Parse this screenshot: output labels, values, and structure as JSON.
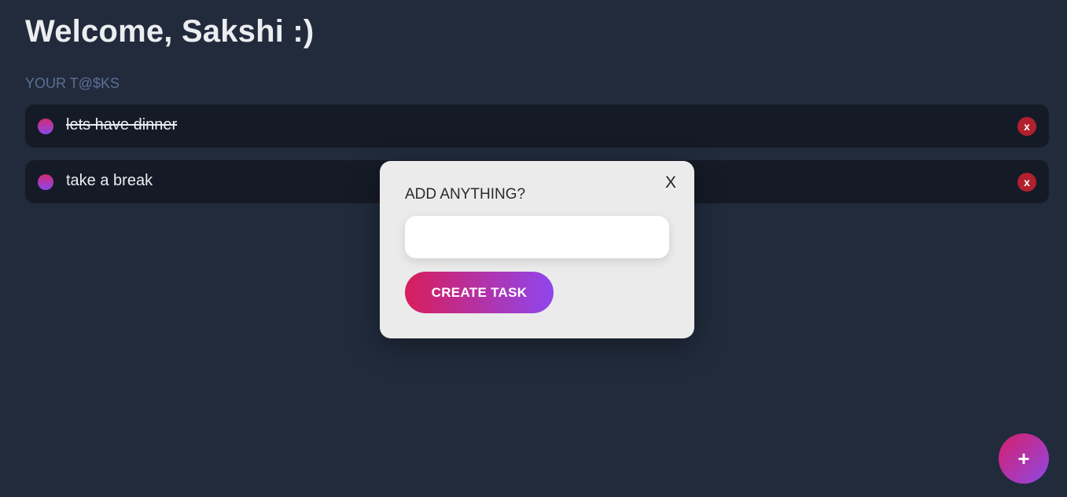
{
  "header": {
    "welcome": "Welcome, Sakshi :)"
  },
  "tasks_section": {
    "label": "YOUR T@$KS"
  },
  "tasks": [
    {
      "text": "lets have dinner",
      "completed": true,
      "delete_label": "x"
    },
    {
      "text": "take a break",
      "completed": false,
      "delete_label": "x"
    }
  ],
  "modal": {
    "close_label": "X",
    "title": "ADD ANYTHING?",
    "input_value": "",
    "create_label": "CREATE TASK"
  },
  "fab": {
    "label": "+",
    "icon": "plus-icon"
  },
  "colors": {
    "background": "#212b3c",
    "task_card": "#151b26",
    "accent_start": "#d81e5b",
    "accent_end": "#8f46ee",
    "delete": "#b0212d"
  }
}
